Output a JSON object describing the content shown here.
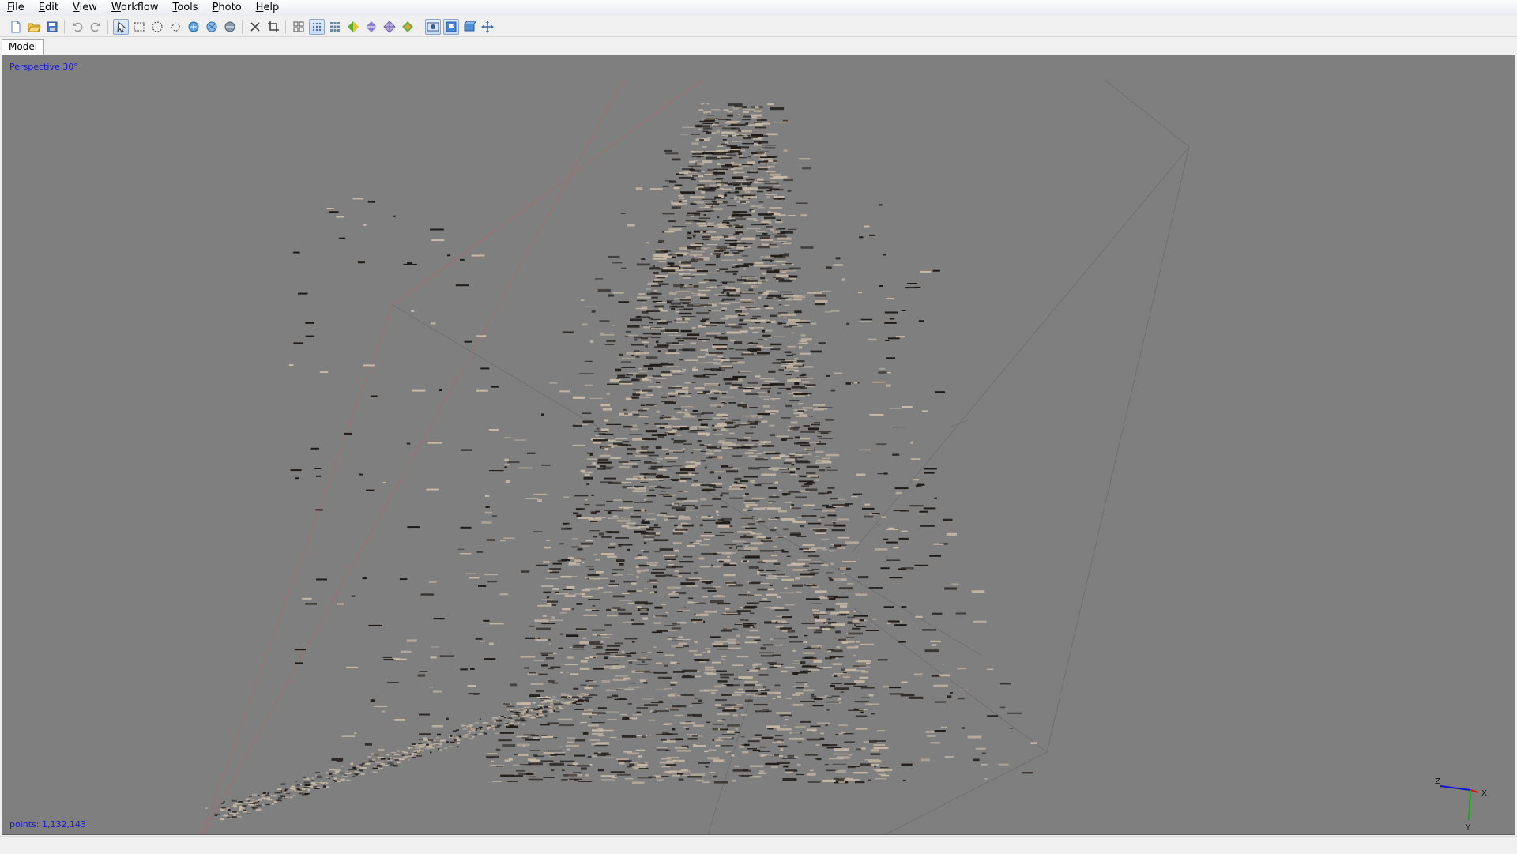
{
  "menu": [
    {
      "label": "File",
      "name": "menu-file"
    },
    {
      "label": "Edit",
      "name": "menu-edit"
    },
    {
      "label": "View",
      "name": "menu-view"
    },
    {
      "label": "Workflow",
      "name": "menu-workflow"
    },
    {
      "label": "Tools",
      "name": "menu-tools"
    },
    {
      "label": "Photo",
      "name": "menu-photo"
    },
    {
      "label": "Help",
      "name": "menu-help"
    }
  ],
  "toolbar": {
    "buttons": [
      {
        "icon": "new-document-icon",
        "pressed": false
      },
      {
        "icon": "open-folder-icon",
        "pressed": false
      },
      {
        "icon": "save-icon",
        "pressed": false
      },
      {
        "sep": true
      },
      {
        "icon": "undo-icon",
        "pressed": false
      },
      {
        "icon": "redo-icon",
        "pressed": false
      },
      {
        "sep": true
      },
      {
        "icon": "navigation-cursor-icon",
        "pressed": true
      },
      {
        "icon": "rectangle-selection-icon",
        "pressed": false
      },
      {
        "icon": "circle-selection-icon",
        "pressed": false
      },
      {
        "icon": "free-form-selection-icon",
        "pressed": false
      },
      {
        "icon": "gradual-selection-icon",
        "pressed": false
      },
      {
        "icon": "select-points-icon",
        "pressed": false
      },
      {
        "icon": "shape-select-icon",
        "pressed": false
      },
      {
        "sep": true
      },
      {
        "icon": "delete-selection-icon",
        "pressed": false
      },
      {
        "icon": "crop-selection-icon",
        "pressed": false
      },
      {
        "sep": true
      },
      {
        "icon": "show-cameras-icon",
        "pressed": false
      },
      {
        "icon": "point-cloud-icon",
        "pressed": true
      },
      {
        "icon": "dense-cloud-icon",
        "pressed": false
      },
      {
        "icon": "shaded-model-icon",
        "pressed": false
      },
      {
        "icon": "solid-model-icon",
        "pressed": false
      },
      {
        "icon": "wireframe-model-icon",
        "pressed": false
      },
      {
        "icon": "textured-model-icon",
        "pressed": false
      },
      {
        "sep": true
      },
      {
        "icon": "show-photos-icon",
        "pressed": true
      },
      {
        "icon": "show-markers-icon",
        "pressed": true
      },
      {
        "icon": "show-region-icon",
        "pressed": false
      },
      {
        "icon": "reset-view-icon",
        "pressed": false
      }
    ]
  },
  "tabs": [
    {
      "label": "Model"
    }
  ],
  "viewport": {
    "projection": "Perspective 30°",
    "points": "points: 1,132,143",
    "axes": {
      "x": "X",
      "y": "Y",
      "z": "Z"
    },
    "colors": {
      "background": "#7f7f7f",
      "region_front": "#a66a6a",
      "region_back": "#6c6c6c",
      "points_light": "#c8b9a6",
      "points_dark": "#1f1a16",
      "axis_x": "#e01010",
      "axis_y": "#10b010",
      "axis_z": "#1010e0"
    }
  }
}
